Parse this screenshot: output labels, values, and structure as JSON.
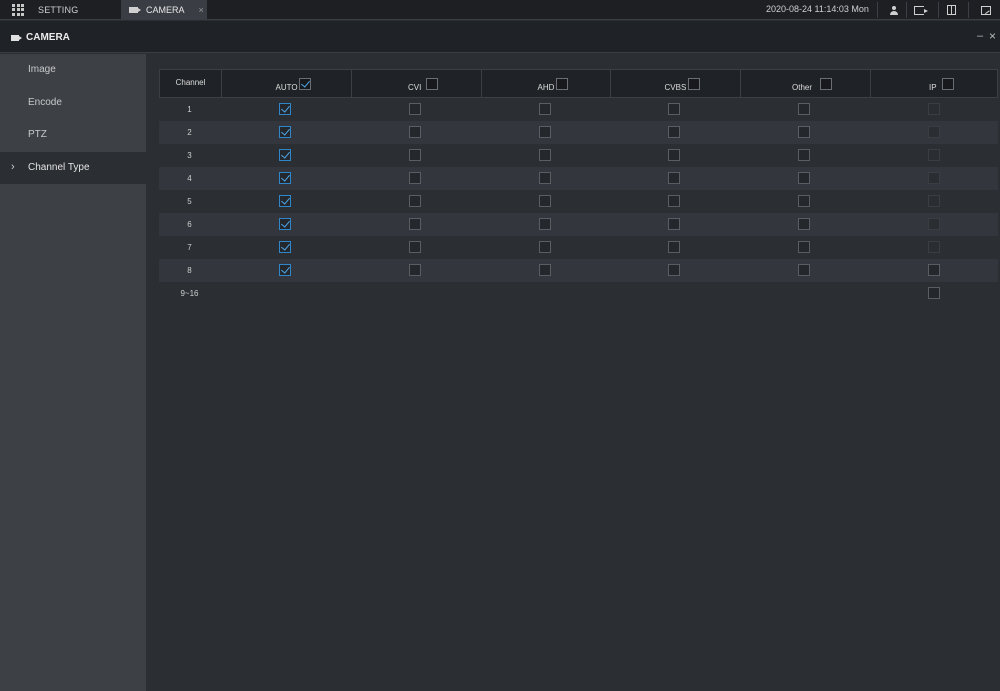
{
  "topbar": {
    "setting_label": "SETTING",
    "camera_tab_label": "CAMERA",
    "camera_tab_close": "×",
    "datetime": "2020-08-24 11:14:03 Mon",
    "icons": [
      "apps-grid-icon",
      "camera-icon",
      "user-icon",
      "logout-icon",
      "layout-icon",
      "monitor-icon"
    ]
  },
  "window": {
    "title": "CAMERA",
    "minimize": "–",
    "close": "×"
  },
  "sidebar": {
    "items": [
      {
        "label": "Image",
        "active": false
      },
      {
        "label": "Encode",
        "active": false
      },
      {
        "label": "PTZ",
        "active": false
      },
      {
        "label": "Channel Type",
        "active": true
      }
    ],
    "active_chevron": "›"
  },
  "table": {
    "headers": [
      {
        "label": "Channel"
      },
      {
        "label": "AUTO",
        "checked": true
      },
      {
        "label": "CVI",
        "checked": false
      },
      {
        "label": "AHD",
        "checked": false
      },
      {
        "label": "CVBS",
        "checked": false
      },
      {
        "label": "Other",
        "checked": false
      },
      {
        "label": "IP",
        "checked": false
      }
    ],
    "rows": [
      {
        "channel": "1",
        "auto": true,
        "cvi": false,
        "ahd": false,
        "cvbs": false,
        "other": false,
        "ip": false
      },
      {
        "channel": "2",
        "auto": true,
        "cvi": false,
        "ahd": false,
        "cvbs": false,
        "other": false,
        "ip": false
      },
      {
        "channel": "3",
        "auto": true,
        "cvi": false,
        "ahd": false,
        "cvbs": false,
        "other": false,
        "ip": false
      },
      {
        "channel": "4",
        "auto": true,
        "cvi": false,
        "ahd": false,
        "cvbs": false,
        "other": false,
        "ip": false
      },
      {
        "channel": "5",
        "auto": true,
        "cvi": false,
        "ahd": false,
        "cvbs": false,
        "other": false,
        "ip": false
      },
      {
        "channel": "6",
        "auto": true,
        "cvi": false,
        "ahd": false,
        "cvbs": false,
        "other": false,
        "ip": false
      },
      {
        "channel": "7",
        "auto": true,
        "cvi": false,
        "ahd": false,
        "cvbs": false,
        "other": false,
        "ip": false
      },
      {
        "channel": "8",
        "auto": true,
        "cvi": false,
        "ahd": false,
        "cvbs": false,
        "other": false,
        "ip": false
      },
      {
        "channel": "9~16",
        "ip_only": true,
        "ip": false
      }
    ]
  },
  "colors": {
    "accent": "#2f86c9",
    "background": "#2b2e33",
    "sidebar": "#3d4146",
    "topbar": "#1d1f23"
  }
}
